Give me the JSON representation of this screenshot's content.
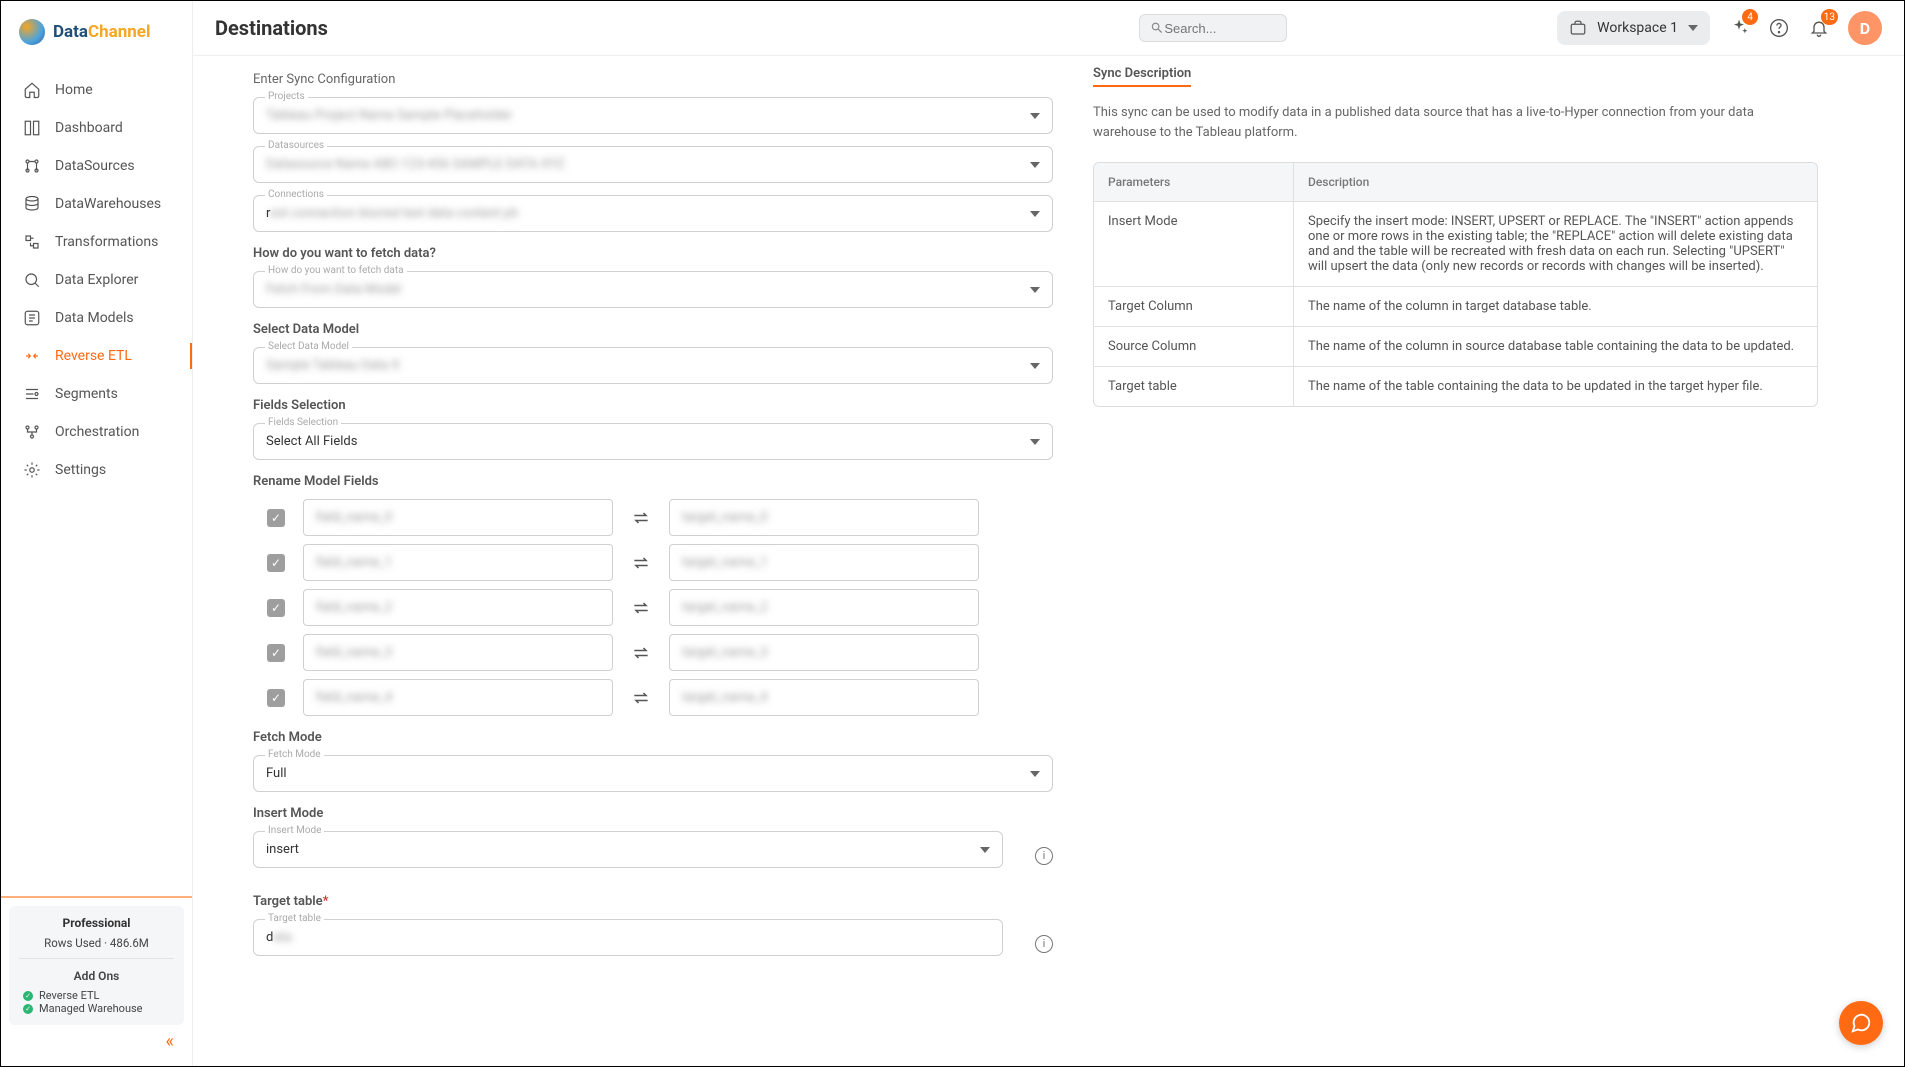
{
  "logo_parts": {
    "data": "Data",
    "channel": "Channel"
  },
  "page_title": "Destinations",
  "search_placeholder": "Search...",
  "workspace": "Workspace 1",
  "badges": {
    "sparkle": "4",
    "bell": "13"
  },
  "avatar_initial": "D",
  "nav": [
    {
      "label": "Home",
      "active": false
    },
    {
      "label": "Dashboard",
      "active": false
    },
    {
      "label": "DataSources",
      "active": false
    },
    {
      "label": "DataWarehouses",
      "active": false
    },
    {
      "label": "Transformations",
      "active": false
    },
    {
      "label": "Data Explorer",
      "active": false
    },
    {
      "label": "Data Models",
      "active": false
    },
    {
      "label": "Reverse ETL",
      "active": true
    },
    {
      "label": "Segments",
      "active": false
    },
    {
      "label": "Orchestration",
      "active": false
    },
    {
      "label": "Settings",
      "active": false
    }
  ],
  "plan": {
    "title": "Professional",
    "rows": "Rows Used · 486.6M",
    "addons_title": "Add Ons",
    "addon1": "Reverse ETL",
    "addon2": "Managed Warehouse"
  },
  "form": {
    "sync_config": "Enter Sync Configuration",
    "projects_label": "Projects",
    "datasources_label": "Datasources",
    "connections_label": "Connections",
    "connections_prefix": "r",
    "fetch_q": "How do you want to fetch data?",
    "fetch_label": "How do you want to fetch data",
    "select_model": "Select Data Model",
    "select_model_label": "Select Data Model",
    "fields_selection": "Fields Selection",
    "fields_selection_label": "Fields Selection",
    "fields_selection_value": "Select All Fields",
    "rename_fields": "Rename Model Fields",
    "rename_rows": 5,
    "fetch_mode": "Fetch Mode",
    "fetch_mode_label": "Fetch Mode",
    "fetch_mode_value": "Full",
    "insert_mode": "Insert Mode",
    "insert_mode_label": "Insert Mode",
    "insert_mode_value": "insert",
    "target_table": "Target table",
    "target_table_label": "Target table",
    "target_table_prefix": "d"
  },
  "sync": {
    "title": "Sync Description",
    "desc": "This sync can be used to modify data in a published data source that has a live-to-Hyper connection from your data warehouse to the Tableau platform.",
    "th_param": "Parameters",
    "th_desc": "Description",
    "rows": [
      {
        "p": "Insert Mode",
        "d": "Specify the insert mode: INSERT, UPSERT or REPLACE. The \"INSERT\" action appends one or more rows in the existing table; the \"REPLACE\" action will delete existing data and and the table will be recreated with fresh data on each run. Selecting \"UPSERT\" will upsert the data (only new records or records with changes will be inserted)."
      },
      {
        "p": "Target Column",
        "d": "The name of the column in target database table."
      },
      {
        "p": "Source Column",
        "d": "The name of the column in source database table containing the data to be updated."
      },
      {
        "p": "Target table",
        "d": "The name of the table containing the data to be updated in the target hyper file."
      }
    ]
  }
}
